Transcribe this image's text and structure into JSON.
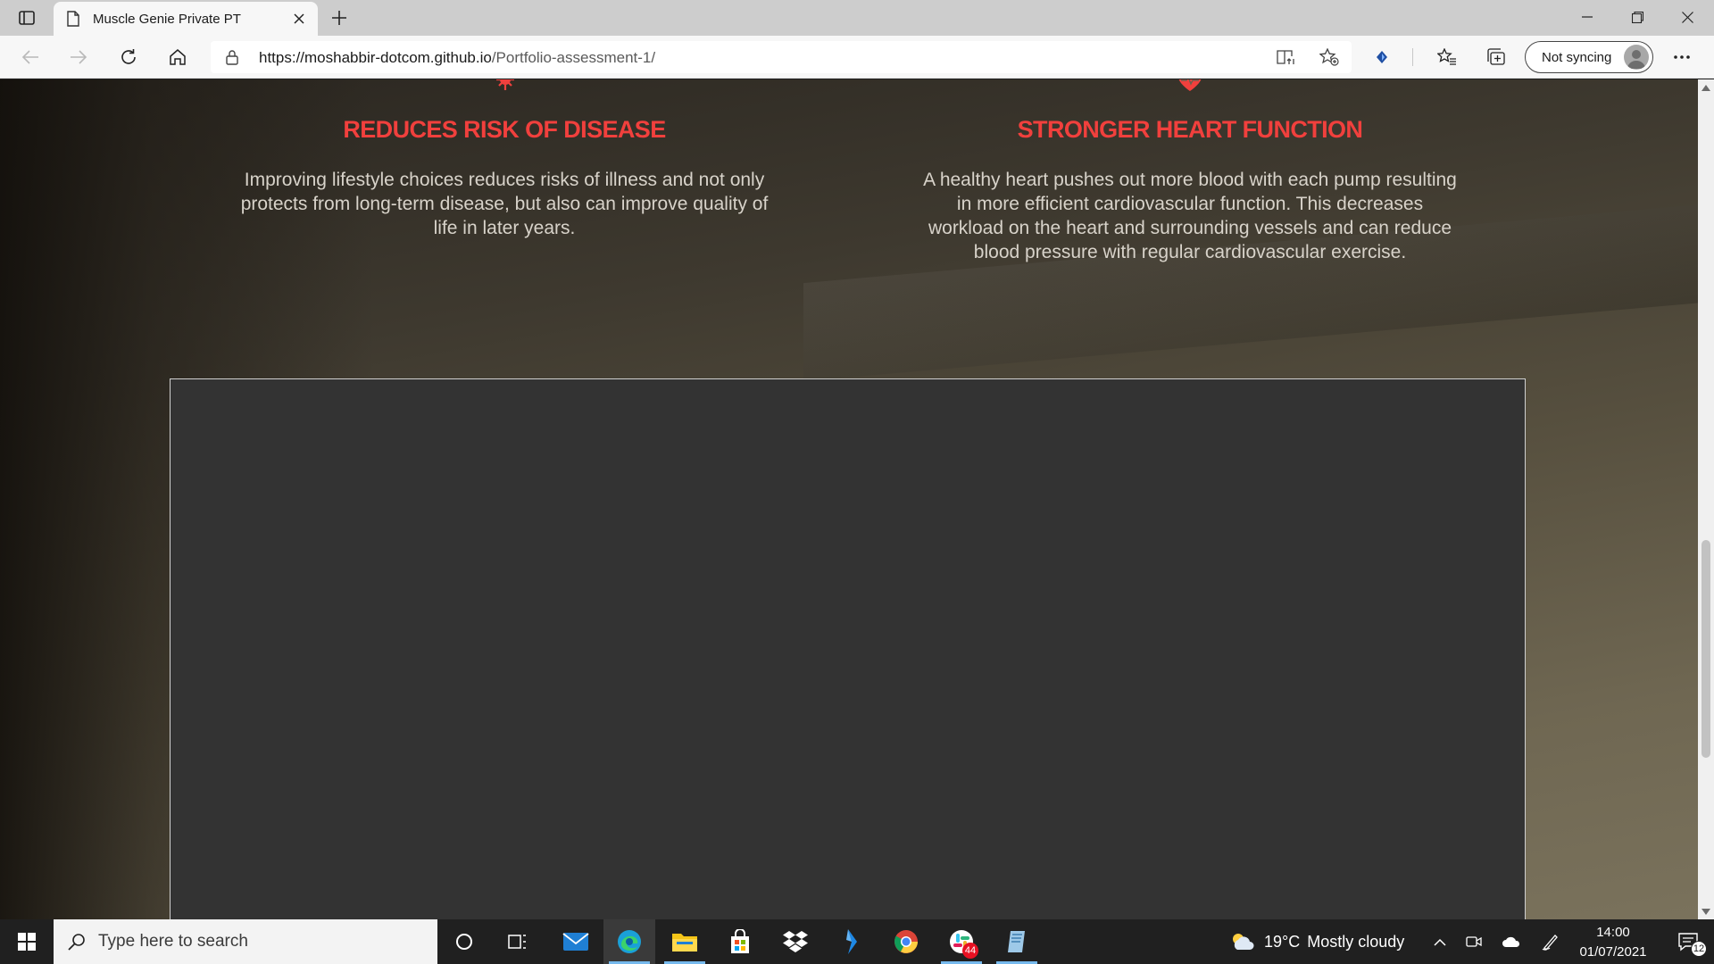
{
  "browser": {
    "tab": {
      "title": "Muscle Genie Private PT",
      "favicon": "page-icon"
    },
    "url_host": "https://moshabbir-dotcom.github.io",
    "url_path": "/Portfolio-assessment-1/",
    "sync_label": "Not syncing",
    "accent": "#cdcdcd"
  },
  "features": [
    {
      "icon": "virus-icon",
      "title": "REDUCES RISK OF DISEASE",
      "text": "Improving lifestyle choices reduces risks of illness and not only protects from long-term disease, but also can improve quality of life in later years."
    },
    {
      "icon": "heart-icon",
      "title": "STRONGER HEART FUNCTION",
      "text": "A healthy heart pushes out more blood with each pump resulting in more efficient cardiovascular function. This decreases workload on the heart and surrounding vessels and can reduce blood pressure with regular cardiovascular exercise."
    }
  ],
  "colors": {
    "feature_title": "#f1403d",
    "panel": "#333333",
    "taskbar": "#202020"
  },
  "taskbar": {
    "search_placeholder": "Type here to search",
    "weather": {
      "temp": "19°C",
      "condition": "Mostly cloudy"
    },
    "slack_badge": "44",
    "notifications_count": "12",
    "time": "14:00",
    "date": "01/07/2021"
  }
}
